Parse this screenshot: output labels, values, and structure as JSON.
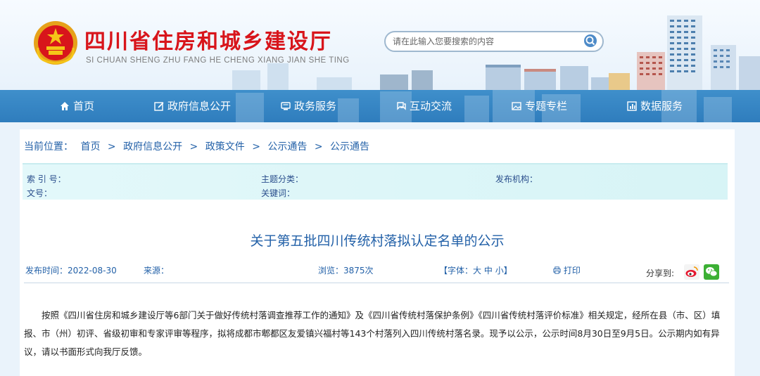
{
  "site": {
    "title": "四川省住房和城乡建设厅",
    "subtitle": "SI CHUAN SHENG ZHU FANG HE CHENG XIANG JIAN SHE TING",
    "brand_red": "#d8151b",
    "brand_blue": "#2f7dbd"
  },
  "search": {
    "placeholder": "请在此输入您要搜索的内容",
    "icon": "search-icon"
  },
  "nav": {
    "items": [
      {
        "label": "首页",
        "icon": "home-icon"
      },
      {
        "label": "政府信息公开",
        "icon": "edit-icon"
      },
      {
        "label": "政务服务",
        "icon": "monitor-icon"
      },
      {
        "label": "互动交流",
        "icon": "chat-icon"
      },
      {
        "label": "专题专栏",
        "icon": "image-icon"
      },
      {
        "label": "数据服务",
        "icon": "chart-icon"
      }
    ]
  },
  "breadcrumb": {
    "label": "当前位置：",
    "items": [
      "首页",
      "政府信息公开",
      "政策文件",
      "公示通告",
      "公示通告"
    ],
    "separator": ">"
  },
  "meta": {
    "index_no": "索 引 号：",
    "doc_no": "文号：",
    "topic": "主题分类：",
    "keywords": "关键词：",
    "publisher": "发布机构："
  },
  "article": {
    "title": "关于第五批四川传统村落拟认定名单的公示",
    "publish_time": "发布时间：2022-08-30",
    "source": "来源：",
    "views": "浏览：3875次",
    "font_size": "【字体：",
    "font_large": "大",
    "font_medium": "中",
    "font_small": "小",
    "font_close": "】",
    "print": "打印",
    "share_label": "分享到:",
    "body": "按照《四川省住房和城乡建设厅等6部门关于做好传统村落调查推荐工作的通知》及《四川省传统村落保护条例》《四川省传统村落评价标准》相关规定，经所在县（市、区）填报、市（州）初评、省级初审和专家评审等程序，拟将成都市郫都区友爱镇兴福村等143个村落列入四川传统村落名录。现予以公示，公示时间8月30日至9月5日。公示期内如有异议，请以书面形式向我厅反馈。"
  }
}
